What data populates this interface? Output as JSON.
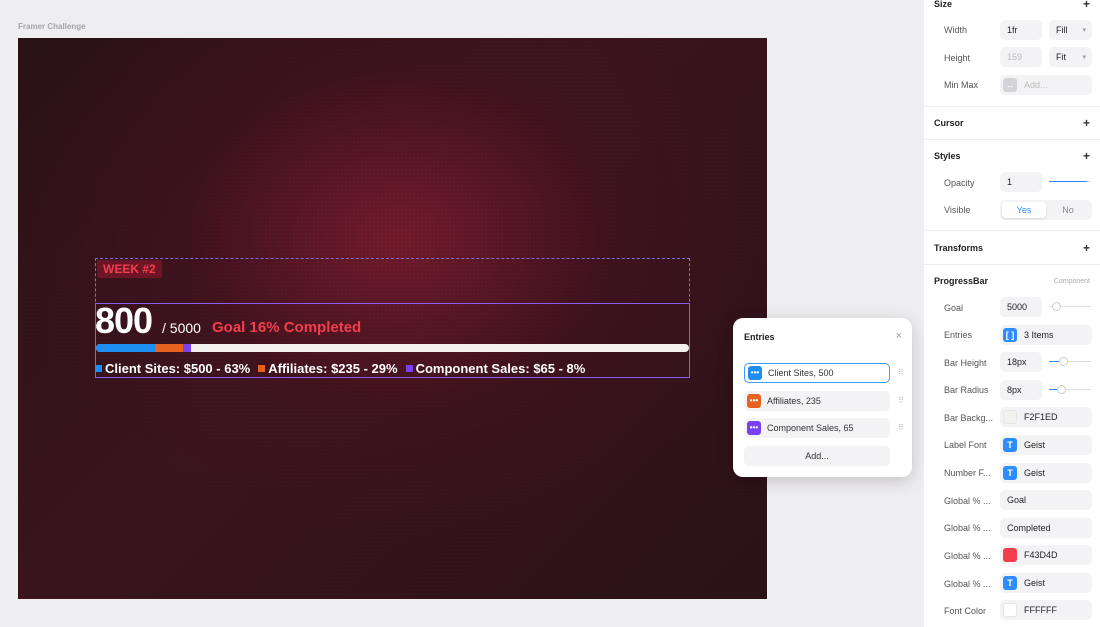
{
  "canvas": {
    "frame_label": "Framer Challenge",
    "week_badge": "WEEK #2",
    "current": "800",
    "goal_of": "/ 5000",
    "goal_text": "Goal 16% Completed",
    "legend": [
      {
        "label": "Client Sites: $500 - 63%",
        "color": "#1f8ef1"
      },
      {
        "label": "Affiliates: $235 - 29%",
        "color": "#e8621f"
      },
      {
        "label": "Component Sales: $65 - 8%",
        "color": "#7b3ff2"
      }
    ],
    "bar_segments": [
      {
        "value": 500,
        "color": "#1f8ef1"
      },
      {
        "value": 235,
        "color": "#e8621f"
      },
      {
        "value": 65,
        "color": "#7b3ff2"
      }
    ],
    "goal_total": 5000,
    "bar_background": "#f2f1ed"
  },
  "entries_popover": {
    "title": "Entries",
    "close_icon": "×",
    "items": [
      {
        "label": "Client Sites, 500",
        "color": "#1f8ef1"
      },
      {
        "label": "Affiliates, 235",
        "color": "#e8621f"
      },
      {
        "label": "Component Sales, 65",
        "color": "#7b3ff2"
      }
    ],
    "add_label": "Add..."
  },
  "panel": {
    "size": {
      "title": "Size",
      "width_label": "Width",
      "width_value": "1fr",
      "width_mode": "Fill",
      "height_label": "Height",
      "height_value": "159",
      "height_mode": "Fit",
      "minmax_label": "Min Max",
      "minmax_placeholder": "Add..."
    },
    "cursor": {
      "title": "Cursor"
    },
    "styles": {
      "title": "Styles",
      "opacity_label": "Opacity",
      "opacity_value": "1",
      "visible_label": "Visible",
      "visible_yes": "Yes",
      "visible_no": "No"
    },
    "transforms": {
      "title": "Transforms"
    },
    "progress": {
      "title": "ProgressBar",
      "note": "Component",
      "rows": [
        {
          "label": "Goal",
          "value": "5000"
        },
        {
          "label": "Entries",
          "value": "3 Items"
        },
        {
          "label": "Bar Height",
          "value": "18px"
        },
        {
          "label": "Bar Radius",
          "value": "8px"
        },
        {
          "label": "Bar Backg...",
          "value": "F2F1ED"
        },
        {
          "label": "Label Font",
          "value": "Geist"
        },
        {
          "label": "Number F...",
          "value": "Geist"
        },
        {
          "label": "Global % ...",
          "value": "Goal"
        },
        {
          "label": "Global % ...",
          "value": "Completed"
        },
        {
          "label": "Global % ...",
          "value": "F43D4D"
        },
        {
          "label": "Global % ...",
          "value": "Geist"
        },
        {
          "label": "Font Color",
          "value": "FFFFFF"
        }
      ]
    },
    "colors": {
      "accent": "#2d8cff",
      "brand_red": "#f43d4d",
      "font_color_swatch": "#ffffff",
      "bar_bg_swatch": "#f2f1ed"
    }
  }
}
